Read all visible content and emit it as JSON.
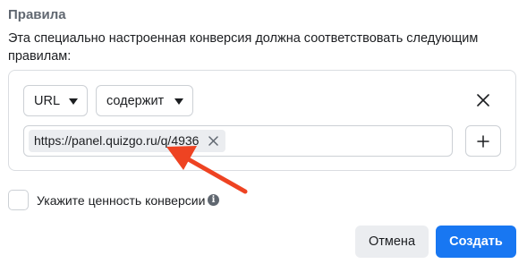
{
  "rules": {
    "title": "Правила",
    "description": "Эта специально настроенная конверсия должна соответствовать следующим правилам:"
  },
  "rule": {
    "field_value": "URL",
    "operator_value": "содержит",
    "tag_value": "https://panel.quizgo.ru/q/4936"
  },
  "conversion_value": {
    "label": "Укажите ценность конверсии",
    "checked": false
  },
  "actions": {
    "cancel_label": "Отмена",
    "create_label": "Создать"
  },
  "icons": {
    "dropdown_caret": "caret-down-icon",
    "remove_rule": "close-icon",
    "remove_tag": "close-icon",
    "add_value": "plus-icon",
    "info": "info-icon",
    "annotation_arrow": "arrow-icon"
  },
  "colors": {
    "primary_button": "#1877f2",
    "annotation_arrow": "#ee4322",
    "secondary_button": "#ebedf0"
  }
}
